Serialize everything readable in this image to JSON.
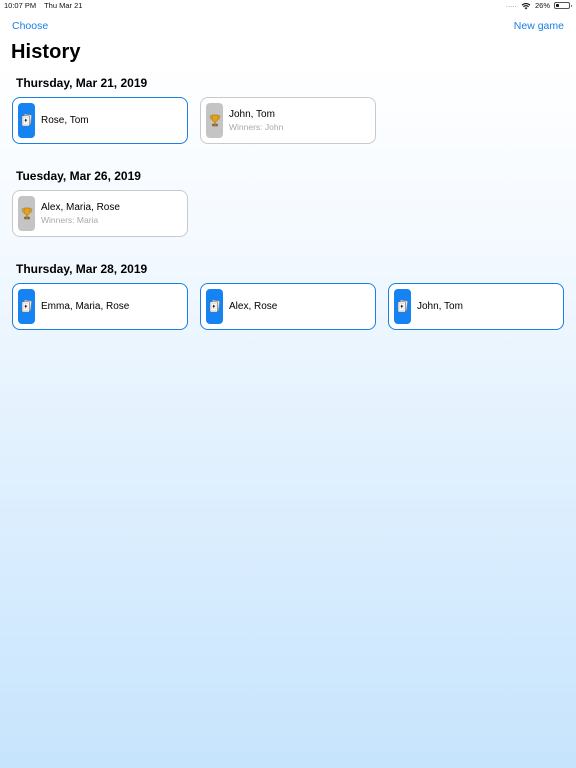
{
  "status_bar": {
    "time": "10:07 PM",
    "date": "Thu Mar 21",
    "signal": ".....",
    "battery_percent": "26%",
    "battery_level": 0.26
  },
  "nav": {
    "left_button": "Choose",
    "right_button": "New game"
  },
  "title": "History",
  "sections": [
    {
      "date": "Thursday, Mar 21, 2019",
      "games": [
        {
          "players": "Rose, Tom",
          "winners": "",
          "state": "active",
          "icon": "cards-icon"
        },
        {
          "players": "John, Tom",
          "winners": "Winners: John",
          "state": "finished",
          "icon": "trophy-icon"
        }
      ]
    },
    {
      "date": "Tuesday, Mar 26, 2019",
      "games": [
        {
          "players": "Alex, Maria, Rose",
          "winners": "Winners: Maria",
          "state": "finished",
          "icon": "trophy-icon"
        }
      ]
    },
    {
      "date": "Thursday, Mar 28, 2019",
      "games": [
        {
          "players": "Emma, Maria, Rose",
          "winners": "",
          "state": "active",
          "icon": "cards-icon"
        },
        {
          "players": "Alex, Rose",
          "winners": "",
          "state": "active",
          "icon": "cards-icon"
        },
        {
          "players": "John, Tom",
          "winners": "",
          "state": "active",
          "icon": "cards-icon"
        }
      ]
    }
  ],
  "colors": {
    "accent": "#1a7ee6",
    "active_badge": "#1683f4",
    "finished_badge": "#c4c4c4",
    "finished_border": "#c9c9c9",
    "winners_text": "#a9a9a9"
  }
}
